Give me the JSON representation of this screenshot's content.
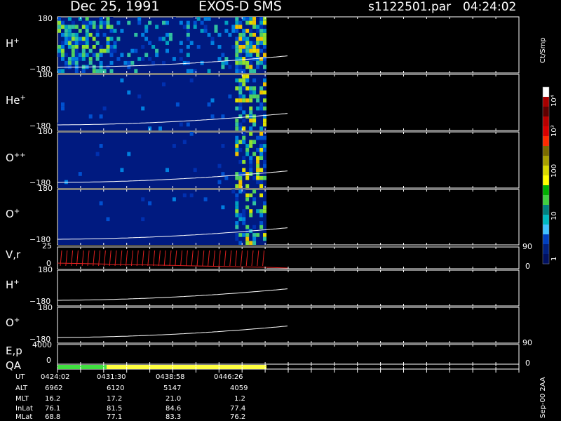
{
  "header": {
    "date": "Dec 25, 1991",
    "instrument": "EXOS-D SMS",
    "file": "s1122501.par",
    "start_time": "04:24:02"
  },
  "panels": {
    "h_plus": {
      "label": "H",
      "sup": "+",
      "top_tick": "180",
      "bottom_tick": "−180"
    },
    "he_plus": {
      "label": "He",
      "sup": "+",
      "top_tick": "180",
      "bottom_tick": "−180"
    },
    "o_plusplus": {
      "label": "O",
      "sup": "++",
      "top_tick": "180",
      "bottom_tick": "−180"
    },
    "o_plus": {
      "label": "O",
      "sup": "+",
      "top_tick": "180",
      "bottom_tick": "−180"
    },
    "vr": {
      "label": "V,r",
      "top_tick": "25",
      "bottom_tick": "0",
      "right_top": "90",
      "right_bottom": "0"
    },
    "h_plus_2": {
      "label": "H",
      "sup": "+",
      "top_tick": "180",
      "bottom_tick": "−180"
    },
    "o_plus_2": {
      "label": "O",
      "sup": "+",
      "top_tick": "180",
      "bottom_tick": "−180"
    },
    "ep": {
      "label": "E,p",
      "top_tick": "4000",
      "bottom_tick": "0",
      "right_top": "90",
      "right_bottom": "0"
    },
    "qa": {
      "label": "QA"
    }
  },
  "colorbar": {
    "unit": "Ct/Smp",
    "labels": [
      "10⁴",
      "10³",
      "100",
      "10",
      "1"
    ],
    "colors": [
      "#ffffff",
      "#a80000",
      "#600000",
      "#b80000",
      "#d80000",
      "#ff2a00",
      "#7a6b00",
      "#a8a000",
      "#d8d800",
      "#ffff00",
      "#00b000",
      "#40d040",
      "#008080",
      "#00b8c0",
      "#40c0ff",
      "#0040c0",
      "#002080",
      "#001060"
    ]
  },
  "footer": {
    "rows": [
      {
        "name": "UT",
        "values": [
          "0424:02",
          "0431:30",
          "0438:58",
          "0446:26"
        ]
      },
      {
        "name": "ALT",
        "values": [
          "6962",
          "6120",
          "5147",
          "4059"
        ]
      },
      {
        "name": "MLT",
        "values": [
          "16.2",
          "17.2",
          "21.0",
          "1.2"
        ]
      },
      {
        "name": "InLat",
        "values": [
          "76.1",
          "81.5",
          "84.6",
          "77.4"
        ]
      },
      {
        "name": "MLat",
        "values": [
          "68.8",
          "77.1",
          "83.3",
          "76.2"
        ]
      }
    ],
    "stamp": "Sep-00 2AA"
  },
  "chart_data": {
    "type": "heatmap",
    "title": "Dec 25, 1991   EXOS-D SMS",
    "x": [
      "0424:02",
      "0431:30",
      "0438:58",
      "0446:26"
    ],
    "panels": [
      "H+",
      "He+",
      "O++",
      "O+",
      "V,r",
      "H+",
      "O+",
      "E,p",
      "QA"
    ],
    "pitch_angle_range": [
      -180,
      180
    ],
    "vr_range": [
      0,
      25
    ],
    "ep_range": [
      0,
      4000
    ],
    "qa_segments": [
      {
        "color": "#40e040",
        "from": "0424:02",
        "to": "0427:00"
      },
      {
        "color": "#ffff40",
        "from": "0427:00",
        "to": "0450:00"
      }
    ]
  }
}
